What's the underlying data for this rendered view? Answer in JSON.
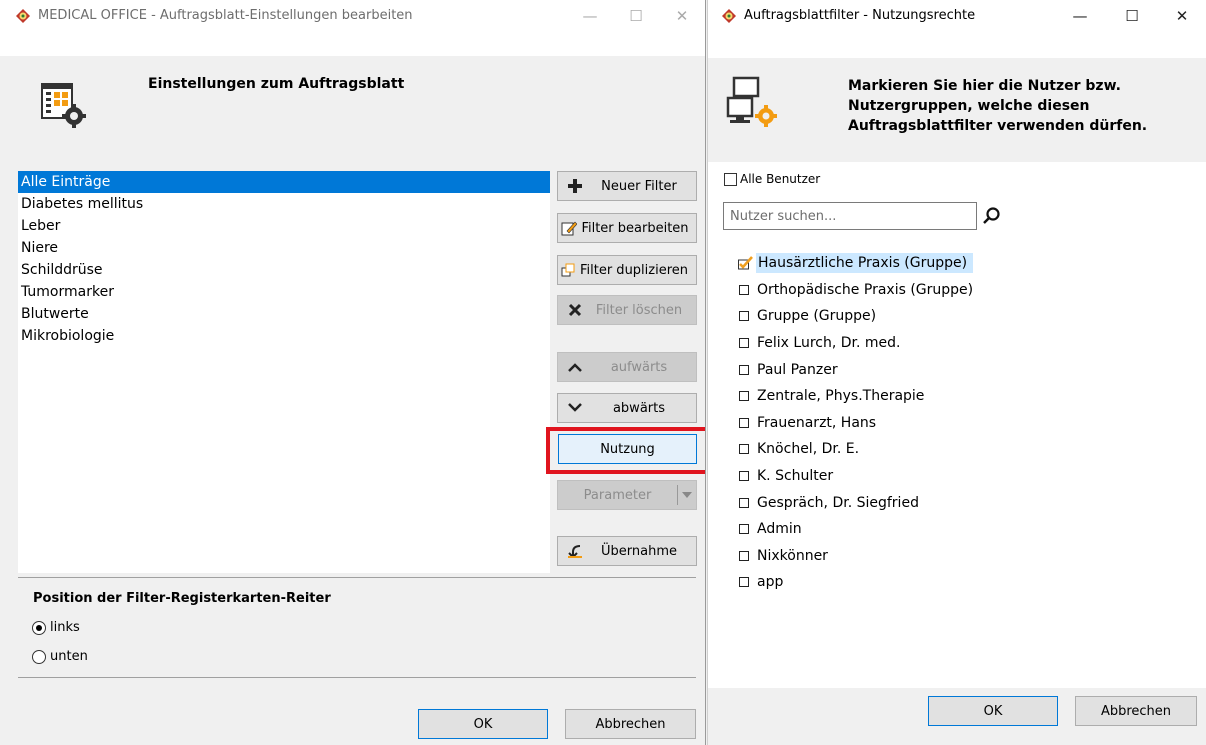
{
  "window1": {
    "title": "MEDICAL OFFICE - Auftragsblatt-Einstellungen bearbeiten",
    "header_title": "Einstellungen zum Auftragsblatt",
    "filters": [
      "Alle Einträge",
      "Diabetes mellitus",
      "Leber",
      "Niere",
      "Schilddrüse",
      "Tumormarker",
      "Blutwerte",
      "Mikrobiologie"
    ],
    "buttons": {
      "new_filter": "Neuer Filter",
      "edit_filter": "Filter bearbeiten",
      "duplicate_filter": "Filter duplizieren",
      "delete_filter": "Filter löschen",
      "up": "aufwärts",
      "down": "abwärts",
      "usage": "Nutzung",
      "parameter": "Parameter",
      "takeover": "Übernahme"
    },
    "position_title": "Position der Filter-Registerkarten-Reiter",
    "position_options": [
      "links",
      "unten"
    ],
    "ok": "OK",
    "cancel": "Abbrechen",
    "controls": {
      "minimize": "—",
      "maximize": "☐",
      "close": "✕"
    }
  },
  "window2": {
    "title": "Auftragsblattfilter - Nutzungsrechte",
    "header_title": "Markieren Sie hier die Nutzer bzw. Nutzergruppen, welche diesen Auftragsblattfilter verwenden dürfen.",
    "all_users_label": "Alle Benutzer",
    "search_placeholder": "Nutzer suchen...",
    "users": [
      "Hausärztliche Praxis (Gruppe)",
      "Orthopädische Praxis (Gruppe)",
      "Gruppe (Gruppe)",
      "Felix Lurch, Dr. med.",
      "Paul Panzer",
      "Zentrale, Phys.Therapie",
      "Frauenarzt, Hans",
      "Knöchel, Dr. E.",
      "K. Schulter",
      "Gespräch, Dr. Siegfried",
      "Admin",
      "Nixkönner",
      "app"
    ],
    "ok": "OK",
    "cancel": "Abbrechen",
    "controls": {
      "minimize": "—",
      "maximize": "☐",
      "close": "✕"
    }
  },
  "colors": {
    "selection": "#0078d7",
    "highlight_frame": "#e0141e",
    "check": "#f0a020"
  }
}
